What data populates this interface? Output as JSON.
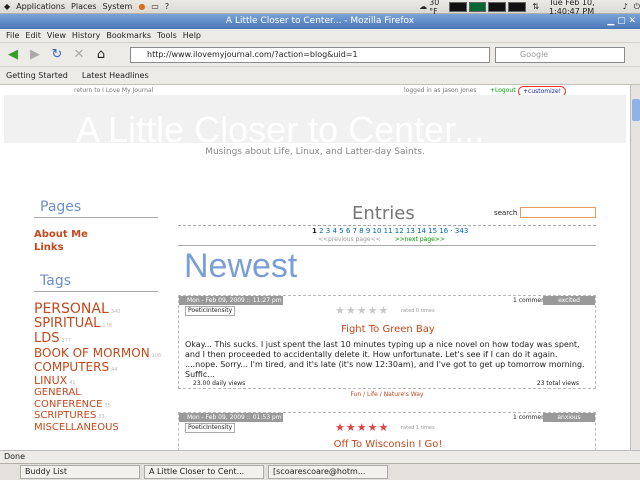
{
  "desktop": {
    "menus": [
      "Applications",
      "Places",
      "System"
    ],
    "temperature": "30 °F",
    "clock": "Tue Feb 10,  1:40:47 PM"
  },
  "window": {
    "title": "A Little Closer to Center... - Mozilla Firefox"
  },
  "menubar": [
    "File",
    "Edit",
    "View",
    "History",
    "Bookmarks",
    "Tools",
    "Help"
  ],
  "nav": {
    "url": "http://www.ilovemyjournal.com/?action=blog&uid=1",
    "search_placeholder": "Google"
  },
  "bookmarks": [
    "Getting Started",
    "Latest Headlines"
  ],
  "page": {
    "return_link": "return to I Love My Journal",
    "logged_in": "logged in as Jason Jones",
    "logout": "+Logout",
    "customize": "+customize!",
    "blog_title": "A Little Closer to Center...",
    "tagline": "Musings about Life, Linux, and Latter-day Saints.",
    "pages_heading": "Pages",
    "pages": [
      "About Me",
      "Links"
    ],
    "tags_heading": "Tags",
    "tags": [
      {
        "name": "PERSONAL",
        "count": "340"
      },
      {
        "name": "SPIRITUAL",
        "count": "178"
      },
      {
        "name": "LDS",
        "count": "177"
      },
      {
        "name": "BOOK OF MORMON",
        "count": "106"
      },
      {
        "name": "COMPUTERS",
        "count": "44"
      },
      {
        "name": "LINUX",
        "count": "41"
      },
      {
        "name": "GENERAL CONFERENCE",
        "count": "35"
      },
      {
        "name": "SCRIPTURES",
        "count": "33"
      },
      {
        "name": "MISCELLANEOUS",
        "count": ""
      }
    ],
    "entries_heading": "Entries",
    "search_label": "search",
    "current_page": "1",
    "pages_list": "2 3 4 5 6 7 8 9 10 11 12 13 14 15 16 · 343",
    "prev_next": "<<previous page<<",
    "next_page": ">>next page>>",
    "newest_heading": "Newest",
    "posts": [
      {
        "date": "Mon - Feb 09, 2009 :: 11:27 pm",
        "author": "PoeticIntensity",
        "comments": "1 comment",
        "mood": "excited",
        "rating_text": "rated 0 times",
        "title": "Fight To Green Bay",
        "body": "Okay...  This sucks.  I just spent the last 10 minutes typing up a nice novel on how today was spent, and I then proceeded to accidentally delete it.  How unfortunate.  Let's see if I can do it again. ....nope.  Sorry...  I'm tired, and it's late (it's now 12:30am), and I've got to get up tomorrow morning. Suffic...",
        "daily_views": "23.00 daily views",
        "total_views": "23 total views",
        "categories": "Fun / Life / Nature's Way"
      },
      {
        "date": "Mon - Feb 09, 2009 :: 01:53 pm",
        "author": "PoeticIntensity",
        "comments": "1 comment",
        "mood": "anxious",
        "rating_text": "rated 1 times",
        "title": "Off To Wisconsin I Go!"
      }
    ]
  },
  "statusbar": {
    "text": "Done"
  },
  "taskbar": [
    "Buddy List",
    "A Little Closer to Cent...",
    "[scoarescoare@hotm..."
  ],
  "colors": {
    "accent": "#c2491d",
    "heading_blue": "#7a9ed6",
    "filled_star": "#e04141",
    "empty_star": "#c8c8c8"
  },
  "ratings": {
    "post1_stars_filled": 0,
    "post2_stars_filled": 5
  }
}
